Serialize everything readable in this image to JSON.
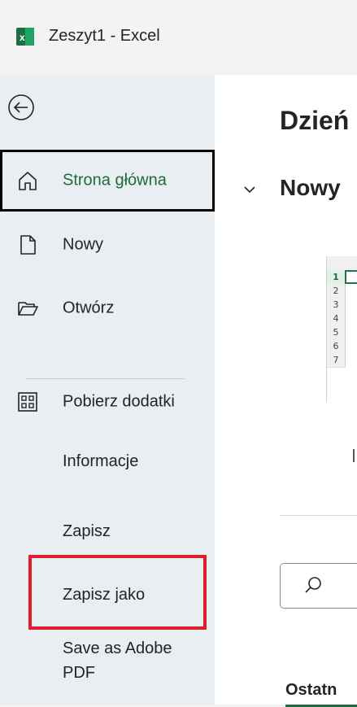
{
  "window": {
    "app_icon": "excel-icon",
    "title": "Zeszyt1  -  Excel"
  },
  "sidebar": {
    "back_icon": "back-arrow-icon",
    "items": [
      {
        "label": "Strona główna",
        "icon": "home-icon",
        "selected": true
      },
      {
        "label": "Nowy",
        "icon": "new-document-icon"
      },
      {
        "label": "Otwórz",
        "icon": "folder-open-icon"
      },
      {
        "label": "Pobierz dodatki",
        "icon": "add-ins-grid-icon"
      },
      {
        "label": "Informacje"
      },
      {
        "label": "Zapisz"
      },
      {
        "label": "Zapisz jako",
        "highlighted": true
      },
      {
        "label": "Save as Adobe PDF"
      }
    ]
  },
  "main": {
    "greeting": "Dzień",
    "new_section_title": "Nowy",
    "template_thumbnail": {
      "row_numbers": [
        "1",
        "2",
        "3",
        "4",
        "5",
        "6",
        "7"
      ]
    },
    "search_icon": "search-icon",
    "recent_tab": "Ostatn"
  },
  "colors": {
    "accent_green": "#1e6b3a",
    "highlight_red": "#e01e2b",
    "sidebar_bg": "#e8eef2"
  }
}
